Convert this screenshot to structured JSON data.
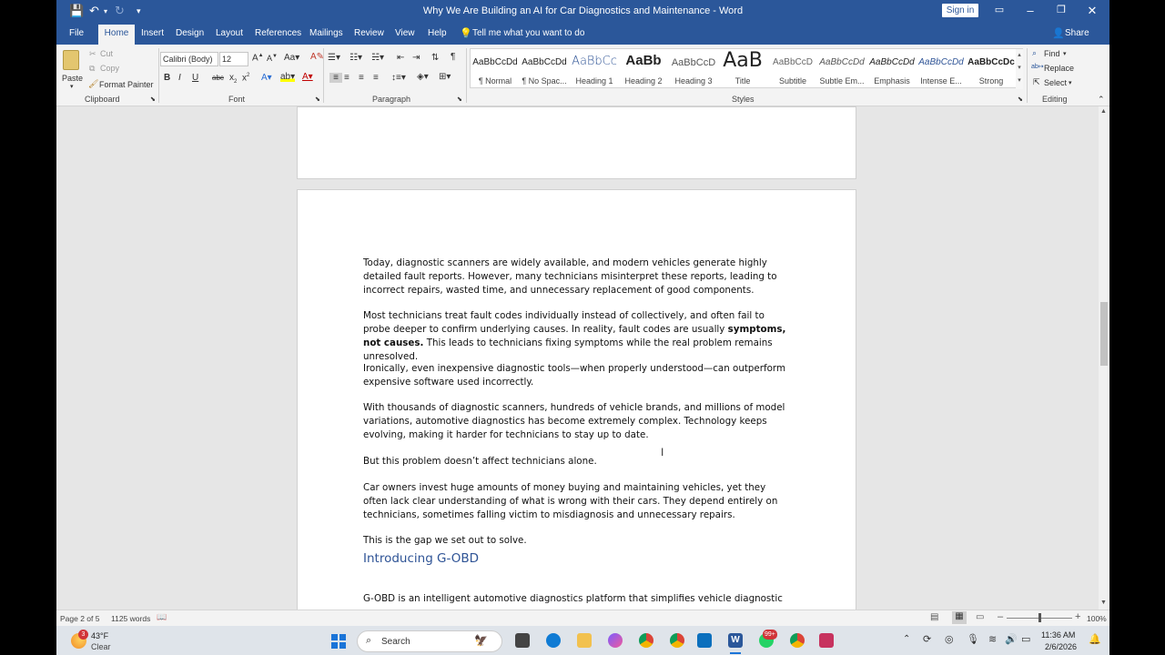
{
  "window": {
    "title": "Why We Are Building an AI for Car Diagnostics and Maintenance  -  Word",
    "sign_in": "Sign in",
    "share": "Share"
  },
  "tabs": [
    "File",
    "Home",
    "Insert",
    "Design",
    "Layout",
    "References",
    "Mailings",
    "Review",
    "View",
    "Help"
  ],
  "active_tab": "Home",
  "tell_me": "Tell me what you want to do",
  "clipboard": {
    "paste": "Paste",
    "cut": "Cut",
    "copy": "Copy",
    "format_painter": "Format Painter",
    "label": "Clipboard"
  },
  "font": {
    "name": "Calibri (Body)",
    "size": "12",
    "label": "Font"
  },
  "paragraph": {
    "label": "Paragraph"
  },
  "styles": {
    "label": "Styles",
    "items": [
      {
        "preview": "AaBbCcDd",
        "name": "¶ Normal"
      },
      {
        "preview": "AaBbCcDd",
        "name": "¶ No Spac..."
      },
      {
        "preview": "AaBbCc",
        "name": "Heading 1"
      },
      {
        "preview": "AaBb",
        "name": "Heading 2"
      },
      {
        "preview": "AaBbCcD",
        "name": "Heading 3"
      },
      {
        "preview": "AaB",
        "name": "Title"
      },
      {
        "preview": "AaBbCcD",
        "name": "Subtitle"
      },
      {
        "preview": "AaBbCcDd",
        "name": "Subtle Em..."
      },
      {
        "preview": "AaBbCcDd",
        "name": "Emphasis"
      },
      {
        "preview": "AaBbCcDd",
        "name": "Intense E..."
      },
      {
        "preview": "AaBbCcDc",
        "name": "Strong"
      }
    ]
  },
  "editing": {
    "find": "Find",
    "replace": "Replace",
    "select": "Select",
    "label": "Editing"
  },
  "document": {
    "p1": "Today, diagnostic scanners are widely available, and modern vehicles generate highly detailed fault reports. However, many technicians misinterpret these reports, leading to incorrect repairs, wasted time, and unnecessary replacement of good components.",
    "p2_a": "Most technicians treat fault codes individually instead of collectively, and often fail to probe deeper to confirm underlying causes. In reality, fault codes are usually ",
    "p2_bold": "symptoms, not causes.",
    "p2_b": " This leads to technicians fixing symptoms while the real problem remains unresolved.",
    "p3": "Ironically, even inexpensive diagnostic tools—when properly understood—can outperform expensive software used incorrectly.",
    "p4": "With thousands of diagnostic scanners, hundreds of vehicle brands, and millions of model variations, automotive diagnostics has become extremely complex. Technology keeps evolving, making it harder for technicians to stay up to date.",
    "p5": "But this problem doesn’t affect technicians alone.",
    "p6": "Car owners invest huge amounts of money buying and maintaining vehicles, yet they often lack clear understanding of what is wrong with their cars. They depend entirely on technicians, sometimes falling victim to misdiagnosis and unnecessary repairs.",
    "p7": "This is the gap we set out to solve.",
    "heading": "Introducing G-OBD",
    "p8": "G-OBD is an intelligent automotive diagnostics platform that simplifies vehicle diagnostic"
  },
  "status": {
    "page": "Page 2 of 5",
    "words": "1125 words",
    "zoom": "100%",
    "zoom_fraction": 0.5
  },
  "taskbar": {
    "weather_temp": "43°F",
    "weather_desc": "Clear",
    "weather_badge": "3",
    "search": "Search",
    "badge": "99+",
    "time": "11:36 AM",
    "date": "2/6/2026"
  },
  "colors": {
    "word_blue": "#2b579a",
    "heading_blue": "#2f5496"
  }
}
